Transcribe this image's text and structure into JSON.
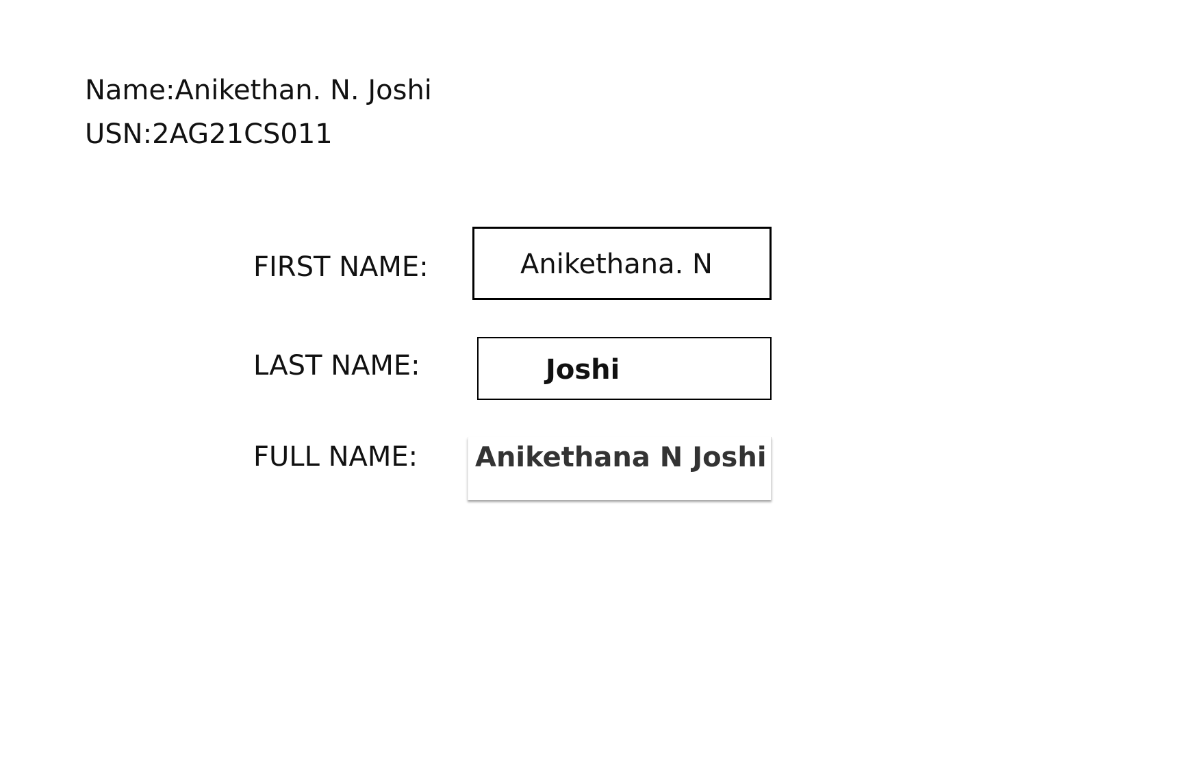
{
  "header": {
    "name_line": "Name:Anikethan. N. Joshi",
    "usn_line": "USN:2AG21CS011"
  },
  "form": {
    "first_name": {
      "label": "FIRST NAME:",
      "value": "Anikethana. N"
    },
    "last_name": {
      "label": "LAST NAME:",
      "value": "Joshi"
    },
    "full_name": {
      "label": "FULL NAME:",
      "value": "Anikethana N Joshi"
    }
  }
}
